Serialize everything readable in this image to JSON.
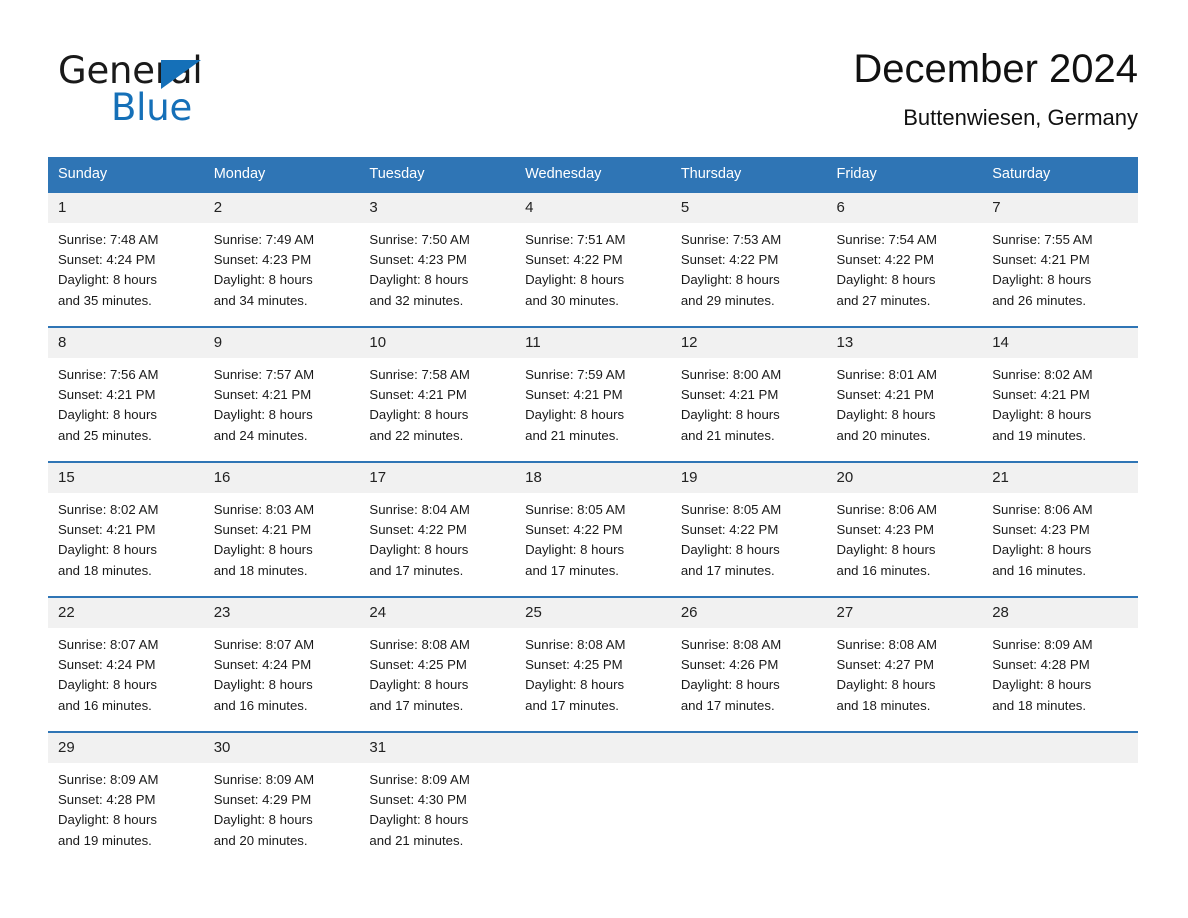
{
  "brand": {
    "name_part1": "General",
    "name_part2": "Blue",
    "logo_icon": "triangle-flag-icon",
    "accent_color": "#1570b8"
  },
  "header": {
    "month_title": "December 2024",
    "location": "Buttenwiesen, Germany"
  },
  "theme": {
    "header_blue": "#2f75b5",
    "daynum_band": "#f1f1f1",
    "text": "#1a1a1a"
  },
  "calendar": {
    "weekday_headers": [
      "Sunday",
      "Monday",
      "Tuesday",
      "Wednesday",
      "Thursday",
      "Friday",
      "Saturday"
    ],
    "weeks": [
      [
        {
          "day": "1",
          "sunrise": "Sunrise: 7:48 AM",
          "sunset": "Sunset: 4:24 PM",
          "daylight_line1": "Daylight: 8 hours",
          "daylight_line2": "and 35 minutes."
        },
        {
          "day": "2",
          "sunrise": "Sunrise: 7:49 AM",
          "sunset": "Sunset: 4:23 PM",
          "daylight_line1": "Daylight: 8 hours",
          "daylight_line2": "and 34 minutes."
        },
        {
          "day": "3",
          "sunrise": "Sunrise: 7:50 AM",
          "sunset": "Sunset: 4:23 PM",
          "daylight_line1": "Daylight: 8 hours",
          "daylight_line2": "and 32 minutes."
        },
        {
          "day": "4",
          "sunrise": "Sunrise: 7:51 AM",
          "sunset": "Sunset: 4:22 PM",
          "daylight_line1": "Daylight: 8 hours",
          "daylight_line2": "and 30 minutes."
        },
        {
          "day": "5",
          "sunrise": "Sunrise: 7:53 AM",
          "sunset": "Sunset: 4:22 PM",
          "daylight_line1": "Daylight: 8 hours",
          "daylight_line2": "and 29 minutes."
        },
        {
          "day": "6",
          "sunrise": "Sunrise: 7:54 AM",
          "sunset": "Sunset: 4:22 PM",
          "daylight_line1": "Daylight: 8 hours",
          "daylight_line2": "and 27 minutes."
        },
        {
          "day": "7",
          "sunrise": "Sunrise: 7:55 AM",
          "sunset": "Sunset: 4:21 PM",
          "daylight_line1": "Daylight: 8 hours",
          "daylight_line2": "and 26 minutes."
        }
      ],
      [
        {
          "day": "8",
          "sunrise": "Sunrise: 7:56 AM",
          "sunset": "Sunset: 4:21 PM",
          "daylight_line1": "Daylight: 8 hours",
          "daylight_line2": "and 25 minutes."
        },
        {
          "day": "9",
          "sunrise": "Sunrise: 7:57 AM",
          "sunset": "Sunset: 4:21 PM",
          "daylight_line1": "Daylight: 8 hours",
          "daylight_line2": "and 24 minutes."
        },
        {
          "day": "10",
          "sunrise": "Sunrise: 7:58 AM",
          "sunset": "Sunset: 4:21 PM",
          "daylight_line1": "Daylight: 8 hours",
          "daylight_line2": "and 22 minutes."
        },
        {
          "day": "11",
          "sunrise": "Sunrise: 7:59 AM",
          "sunset": "Sunset: 4:21 PM",
          "daylight_line1": "Daylight: 8 hours",
          "daylight_line2": "and 21 minutes."
        },
        {
          "day": "12",
          "sunrise": "Sunrise: 8:00 AM",
          "sunset": "Sunset: 4:21 PM",
          "daylight_line1": "Daylight: 8 hours",
          "daylight_line2": "and 21 minutes."
        },
        {
          "day": "13",
          "sunrise": "Sunrise: 8:01 AM",
          "sunset": "Sunset: 4:21 PM",
          "daylight_line1": "Daylight: 8 hours",
          "daylight_line2": "and 20 minutes."
        },
        {
          "day": "14",
          "sunrise": "Sunrise: 8:02 AM",
          "sunset": "Sunset: 4:21 PM",
          "daylight_line1": "Daylight: 8 hours",
          "daylight_line2": "and 19 minutes."
        }
      ],
      [
        {
          "day": "15",
          "sunrise": "Sunrise: 8:02 AM",
          "sunset": "Sunset: 4:21 PM",
          "daylight_line1": "Daylight: 8 hours",
          "daylight_line2": "and 18 minutes."
        },
        {
          "day": "16",
          "sunrise": "Sunrise: 8:03 AM",
          "sunset": "Sunset: 4:21 PM",
          "daylight_line1": "Daylight: 8 hours",
          "daylight_line2": "and 18 minutes."
        },
        {
          "day": "17",
          "sunrise": "Sunrise: 8:04 AM",
          "sunset": "Sunset: 4:22 PM",
          "daylight_line1": "Daylight: 8 hours",
          "daylight_line2": "and 17 minutes."
        },
        {
          "day": "18",
          "sunrise": "Sunrise: 8:05 AM",
          "sunset": "Sunset: 4:22 PM",
          "daylight_line1": "Daylight: 8 hours",
          "daylight_line2": "and 17 minutes."
        },
        {
          "day": "19",
          "sunrise": "Sunrise: 8:05 AM",
          "sunset": "Sunset: 4:22 PM",
          "daylight_line1": "Daylight: 8 hours",
          "daylight_line2": "and 17 minutes."
        },
        {
          "day": "20",
          "sunrise": "Sunrise: 8:06 AM",
          "sunset": "Sunset: 4:23 PM",
          "daylight_line1": "Daylight: 8 hours",
          "daylight_line2": "and 16 minutes."
        },
        {
          "day": "21",
          "sunrise": "Sunrise: 8:06 AM",
          "sunset": "Sunset: 4:23 PM",
          "daylight_line1": "Daylight: 8 hours",
          "daylight_line2": "and 16 minutes."
        }
      ],
      [
        {
          "day": "22",
          "sunrise": "Sunrise: 8:07 AM",
          "sunset": "Sunset: 4:24 PM",
          "daylight_line1": "Daylight: 8 hours",
          "daylight_line2": "and 16 minutes."
        },
        {
          "day": "23",
          "sunrise": "Sunrise: 8:07 AM",
          "sunset": "Sunset: 4:24 PM",
          "daylight_line1": "Daylight: 8 hours",
          "daylight_line2": "and 16 minutes."
        },
        {
          "day": "24",
          "sunrise": "Sunrise: 8:08 AM",
          "sunset": "Sunset: 4:25 PM",
          "daylight_line1": "Daylight: 8 hours",
          "daylight_line2": "and 17 minutes."
        },
        {
          "day": "25",
          "sunrise": "Sunrise: 8:08 AM",
          "sunset": "Sunset: 4:25 PM",
          "daylight_line1": "Daylight: 8 hours",
          "daylight_line2": "and 17 minutes."
        },
        {
          "day": "26",
          "sunrise": "Sunrise: 8:08 AM",
          "sunset": "Sunset: 4:26 PM",
          "daylight_line1": "Daylight: 8 hours",
          "daylight_line2": "and 17 minutes."
        },
        {
          "day": "27",
          "sunrise": "Sunrise: 8:08 AM",
          "sunset": "Sunset: 4:27 PM",
          "daylight_line1": "Daylight: 8 hours",
          "daylight_line2": "and 18 minutes."
        },
        {
          "day": "28",
          "sunrise": "Sunrise: 8:09 AM",
          "sunset": "Sunset: 4:28 PM",
          "daylight_line1": "Daylight: 8 hours",
          "daylight_line2": "and 18 minutes."
        }
      ],
      [
        {
          "day": "29",
          "sunrise": "Sunrise: 8:09 AM",
          "sunset": "Sunset: 4:28 PM",
          "daylight_line1": "Daylight: 8 hours",
          "daylight_line2": "and 19 minutes."
        },
        {
          "day": "30",
          "sunrise": "Sunrise: 8:09 AM",
          "sunset": "Sunset: 4:29 PM",
          "daylight_line1": "Daylight: 8 hours",
          "daylight_line2": "and 20 minutes."
        },
        {
          "day": "31",
          "sunrise": "Sunrise: 8:09 AM",
          "sunset": "Sunset: 4:30 PM",
          "daylight_line1": "Daylight: 8 hours",
          "daylight_line2": "and 21 minutes."
        },
        {
          "day": "",
          "sunrise": "",
          "sunset": "",
          "daylight_line1": "",
          "daylight_line2": ""
        },
        {
          "day": "",
          "sunrise": "",
          "sunset": "",
          "daylight_line1": "",
          "daylight_line2": ""
        },
        {
          "day": "",
          "sunrise": "",
          "sunset": "",
          "daylight_line1": "",
          "daylight_line2": ""
        },
        {
          "day": "",
          "sunrise": "",
          "sunset": "",
          "daylight_line1": "",
          "daylight_line2": ""
        }
      ]
    ]
  }
}
